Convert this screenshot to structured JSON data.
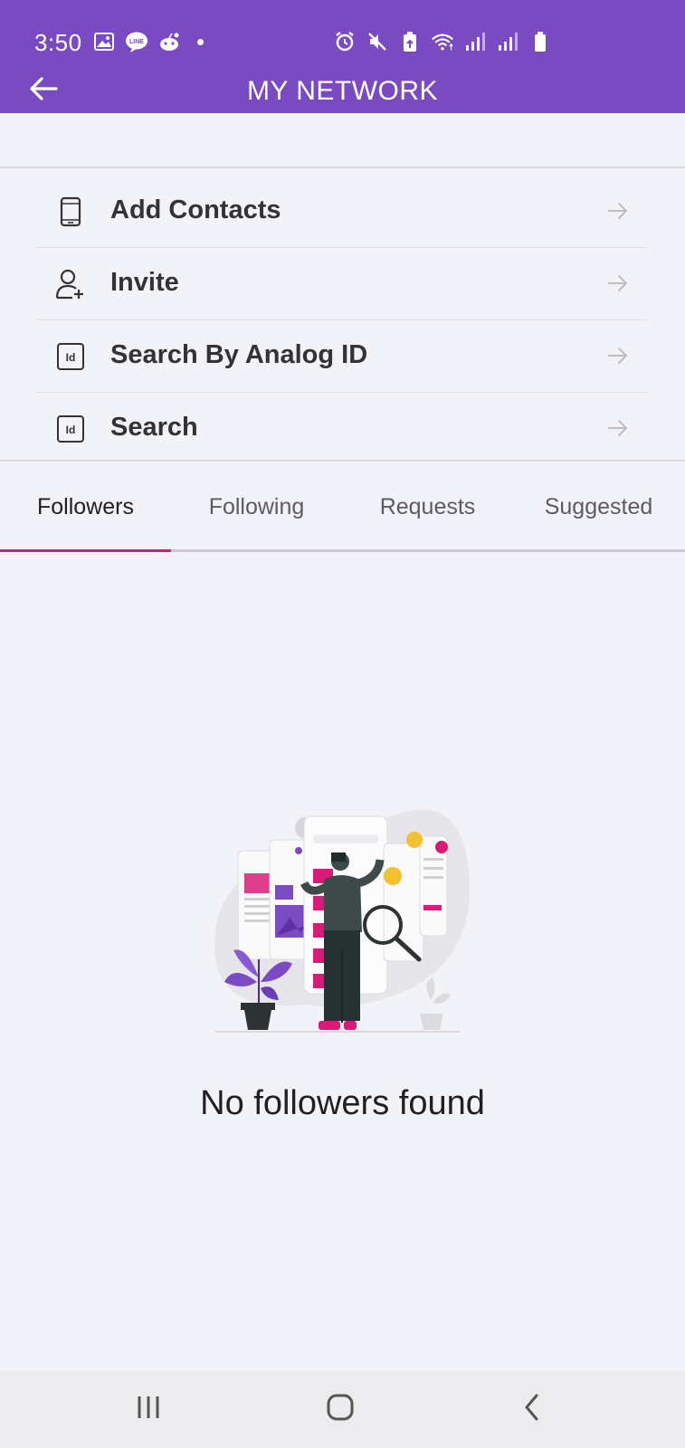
{
  "status_bar": {
    "time": "3:50",
    "left_icons": [
      "image-icon",
      "line-app-icon",
      "reddit-icon",
      "notification-dot-icon"
    ],
    "right_icons": [
      "alarm-icon",
      "mute-icon",
      "battery-saver-icon",
      "wifi-icon",
      "signal-icon",
      "signal-icon-2",
      "battery-icon"
    ]
  },
  "app_bar": {
    "back_icon": "arrow-left-icon",
    "title": "MY NETWORK"
  },
  "menu": {
    "items": [
      {
        "label": "Add Contacts",
        "icon": "phone-icon"
      },
      {
        "label": "Invite",
        "icon": "add-user-icon"
      },
      {
        "label": "Search By Analog ID",
        "icon": "id-card-icon"
      },
      {
        "label": "Search",
        "icon": "id-card-icon"
      }
    ],
    "arrow_icon": "arrow-right-icon"
  },
  "tabs": {
    "items": [
      "Followers",
      "Following",
      "Requests",
      "Suggested"
    ],
    "active": "Followers",
    "indicator_color": "#d81b76"
  },
  "empty_state": {
    "illustration": "person-browsing-screens-illustration",
    "message": "No followers found"
  },
  "nav_bar": {
    "icons": [
      "recent-apps-icon",
      "home-icon",
      "back-icon"
    ]
  },
  "colors": {
    "app_bar": "#7a4ac3",
    "accent": "#d81b76",
    "background": "#f2f3f8"
  }
}
